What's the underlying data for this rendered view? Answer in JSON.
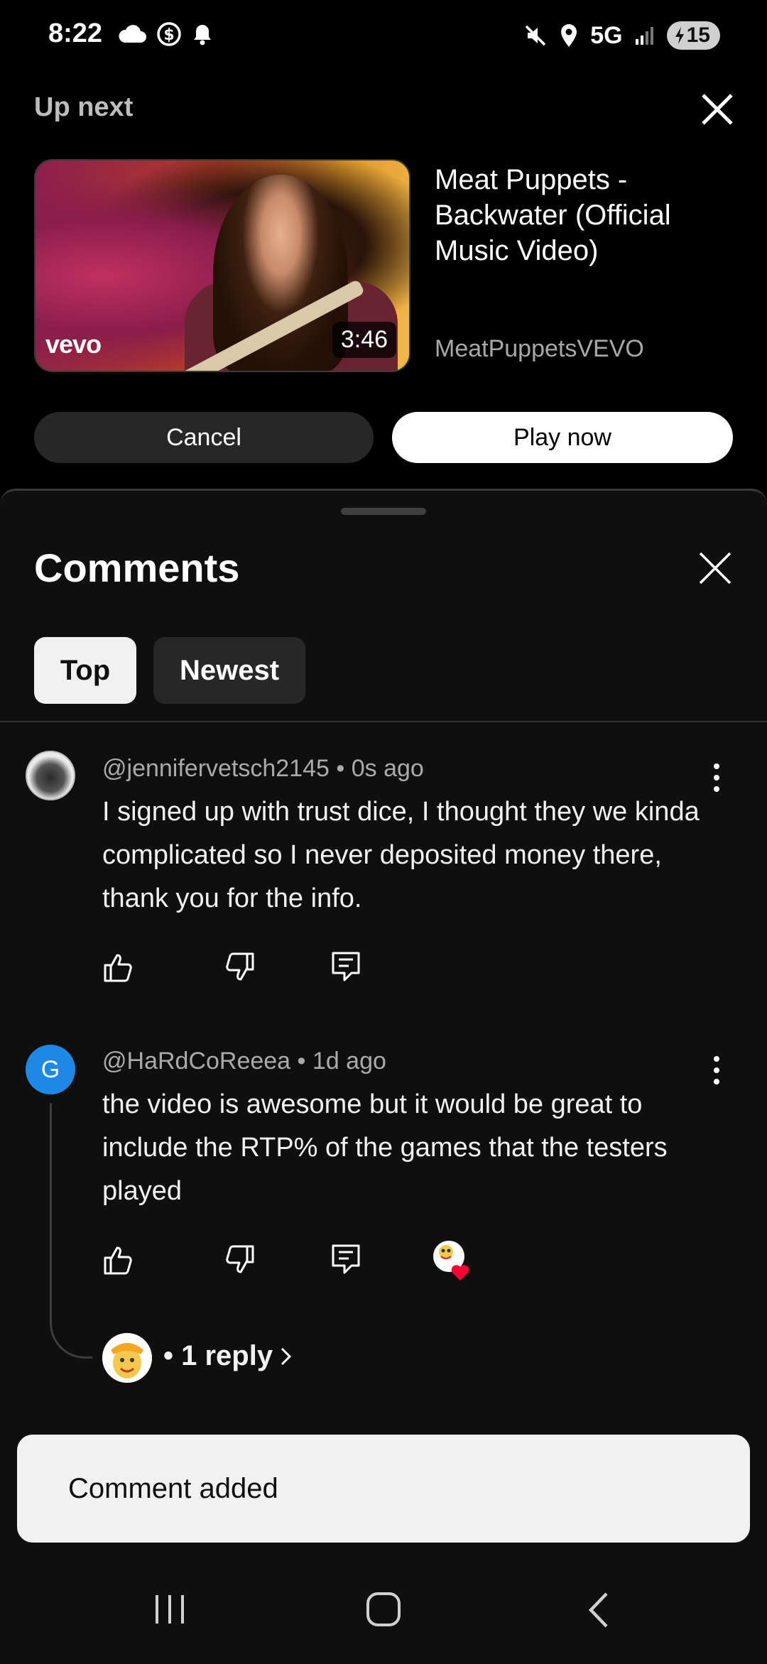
{
  "status_bar": {
    "time": "8:22",
    "network": "5G",
    "battery": "15",
    "left_icons": [
      "cloud-icon",
      "dollar-circle-icon",
      "bell-icon"
    ],
    "right_icons": [
      "mute-icon",
      "location-icon",
      "signal-icon",
      "battery-charging-icon"
    ]
  },
  "up_next": {
    "label": "Up next",
    "title": "Meat Puppets - Backwater (Official Music Video)",
    "channel": "MeatPuppetsVEVO",
    "duration": "3:46",
    "thumbnail_brand": "vevo",
    "cancel_label": "Cancel",
    "play_label": "Play now"
  },
  "comments": {
    "title": "Comments",
    "tabs": [
      {
        "label": "Top",
        "selected": true
      },
      {
        "label": "Newest",
        "selected": false
      }
    ],
    "items": [
      {
        "author": "@jennifervetsch2145",
        "time": "0s ago",
        "separator": "•",
        "text": "I signed up with trust dice, I thought they we kinda complicated so I never deposited money there, thank you for the info."
      },
      {
        "author": "@HaRdCoReeea",
        "time": "1d ago",
        "separator": "•",
        "avatar_letter": "G",
        "text": "the video is awesome but it would be great to include the RTP% of the games that the testers played",
        "reply_label": "• 1 reply"
      }
    ]
  },
  "toast": {
    "message": "Comment added"
  },
  "colors": {
    "background": "#000000",
    "sheet": "#0f0f0f",
    "chip_selected": "#f1f1f1",
    "chip": "#272727",
    "avatar_g": "#1e88e5",
    "heart": "#ff0033"
  }
}
